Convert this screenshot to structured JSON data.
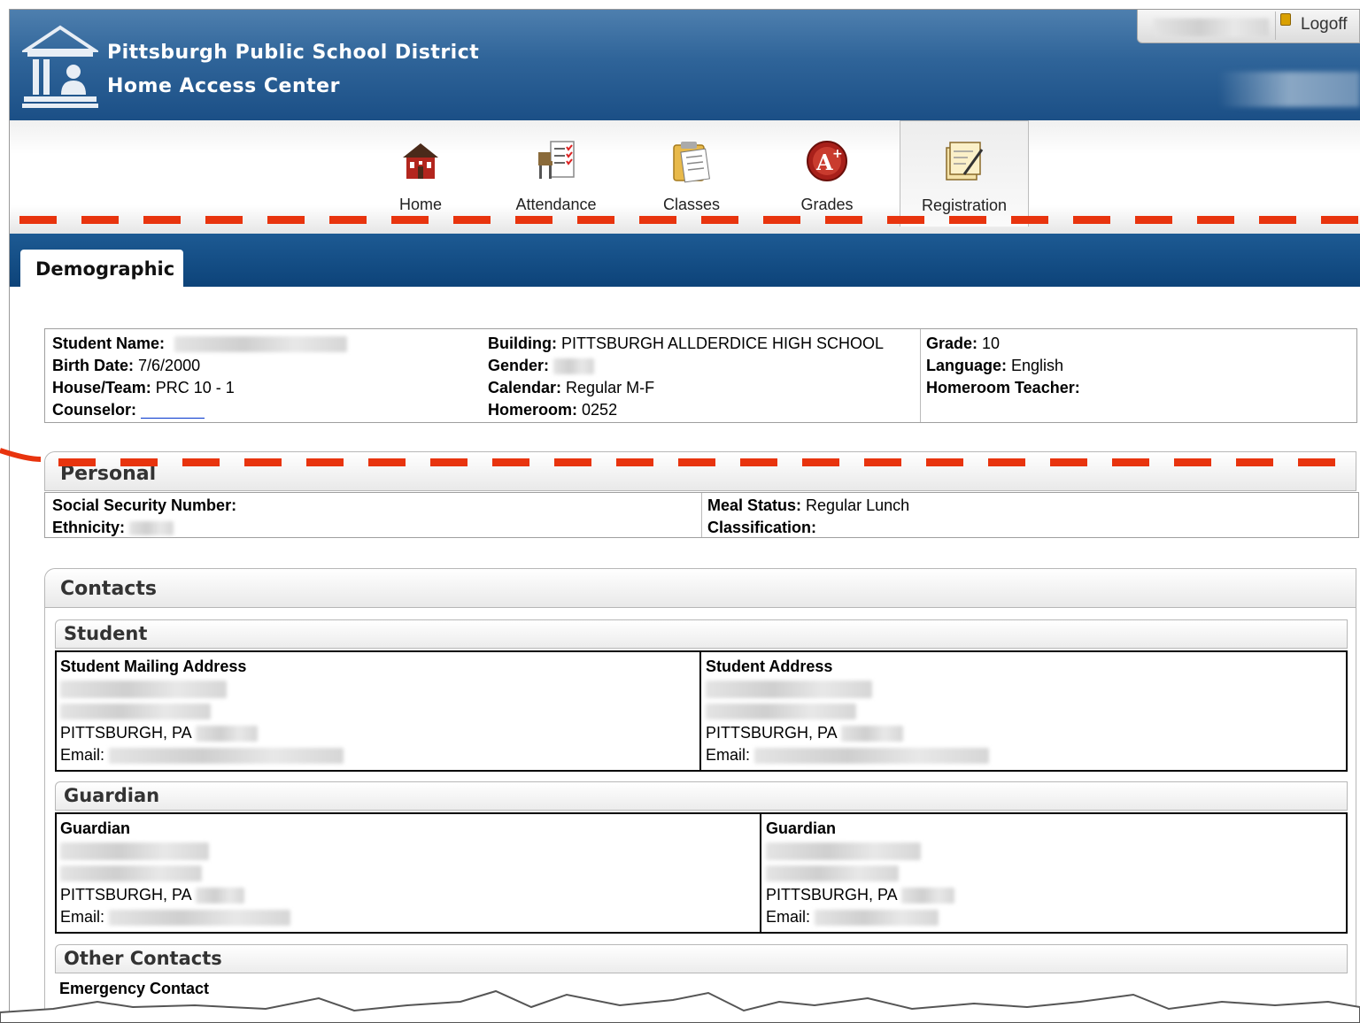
{
  "header": {
    "district": "Pittsburgh Public School District",
    "app": "Home Access Center",
    "logoff": "Logoff"
  },
  "nav": [
    {
      "label": "Home",
      "icon": "home-icon"
    },
    {
      "label": "Attendance",
      "icon": "attendance-icon"
    },
    {
      "label": "Classes",
      "icon": "classes-icon"
    },
    {
      "label": "Grades",
      "icon": "grades-icon"
    },
    {
      "label": "Registration",
      "icon": "registration-icon",
      "selected": true
    }
  ],
  "tab": "Demographic",
  "demographics": {
    "student_name_label": "Student Name:",
    "birth_date_label": "Birth Date:",
    "birth_date": "7/6/2000",
    "house_team_label": "House/Team:",
    "house_team": "PRC 10 - 1",
    "counselor_label": "Counselor:",
    "building_label": "Building:",
    "building": "PITTSBURGH ALLDERDICE HIGH SCHOOL",
    "gender_label": "Gender:",
    "calendar_label": "Calendar:",
    "calendar": "Regular M-F",
    "homeroom_label": "Homeroom:",
    "homeroom": "0252",
    "grade_label": "Grade:",
    "grade": "10",
    "language_label": "Language:",
    "language": "English",
    "homeroom_teacher_label": "Homeroom Teacher:"
  },
  "personal": {
    "title": "Personal",
    "ssn_label": "Social Security Number:",
    "ethnicity_label": "Ethnicity:",
    "meal_status_label": "Meal Status:",
    "meal_status": "Regular Lunch",
    "classification_label": "Classification:"
  },
  "contacts": {
    "title": "Contacts",
    "student_section": "Student",
    "mailing_address_label": "Student Mailing Address",
    "student_address_label": "Student Address",
    "city1": "PITTSBURGH, PA",
    "city2": "PITTSBURGH, PA",
    "email_label": "Email:",
    "guardian_section": "Guardian",
    "guardian1_label": "Guardian",
    "guardian2_label": "Guardian",
    "other_section": "Other Contacts",
    "emergency_label": "Emergency Contact"
  },
  "colors": {
    "header_blue": "#1b4f86",
    "annotation_red": "#e8340e"
  }
}
